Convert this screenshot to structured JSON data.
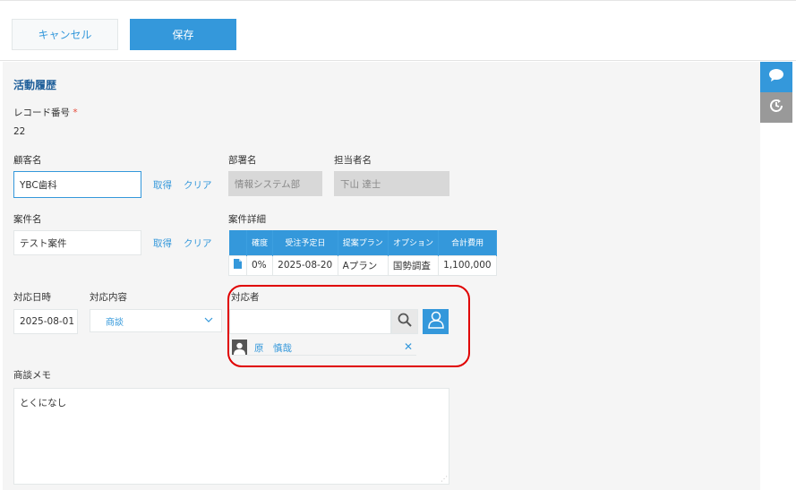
{
  "toolbar": {
    "cancel_label": "キャンセル",
    "save_label": "保存"
  },
  "form": {
    "section_title": "活動履歴",
    "record_number": {
      "label": "レコード番号",
      "required_mark": "*",
      "value": "22"
    },
    "customer": {
      "label": "顧客名",
      "value": "YBC歯科",
      "fetch_label": "取得",
      "clear_label": "クリア"
    },
    "department": {
      "label": "部署名",
      "value": "情報システム部"
    },
    "person_in_charge": {
      "label": "担当者名",
      "value": "下山 達士"
    },
    "project": {
      "label": "案件名",
      "value": "テスト案件",
      "fetch_label": "取得",
      "clear_label": "クリア"
    },
    "project_detail": {
      "label": "案件詳細",
      "columns": [
        "確度",
        "受注予定日",
        "提案プラン",
        "オプション",
        "合計費用"
      ],
      "rows": [
        [
          "0%",
          "2025-08-20",
          "Aプラン",
          "国勢調査",
          "1,100,000"
        ]
      ]
    },
    "response_date": {
      "label": "対応日時",
      "value": "2025-08-01"
    },
    "response_content": {
      "label": "対応内容",
      "selected": "商談"
    },
    "responder": {
      "label": "対応者",
      "search_value": "",
      "selected_users": [
        {
          "name": "原　慎哉"
        }
      ]
    },
    "memo": {
      "label": "商談メモ",
      "value": "とくになし"
    }
  },
  "rail": {
    "icons": [
      "comment-icon",
      "history-icon"
    ]
  },
  "colors": {
    "accent": "#3498db",
    "title": "#1f5f9a",
    "required": "#e74c3c",
    "highlight": "#e00000"
  }
}
